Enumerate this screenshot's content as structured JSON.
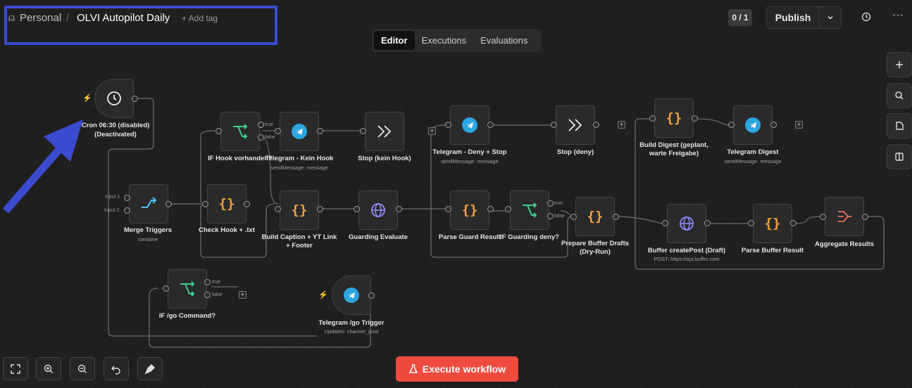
{
  "header": {
    "project": "Personal",
    "workflow_name": "OLVI Autopilot Daily",
    "add_tag": "+ Add tag",
    "counter": "0 / 1",
    "publish": "Publish"
  },
  "tabs": [
    {
      "label": "Editor",
      "active": true
    },
    {
      "label": "Executions",
      "active": false
    },
    {
      "label": "Evaluations",
      "active": false
    }
  ],
  "nodes": {
    "cron": {
      "title": "Cron 06:30 (disabled)",
      "title2": "(Deactivated)"
    },
    "merge": {
      "title": "Merge Triggers",
      "sub": "combine",
      "in1": "Input 1",
      "in2": "Input 2"
    },
    "if_hook": {
      "title": "IF Hook vorhanden?"
    },
    "tg_kein_hook": {
      "title": "Telegram - Kein Hook",
      "sub": "sendMessage: message"
    },
    "stop_kein_hook": {
      "title": "Stop (kein Hook)"
    },
    "tg_deny_stop": {
      "title": "Telegram - Deny + Stop",
      "sub": "sendMessage: message"
    },
    "stop_deny": {
      "title": "Stop (deny)"
    },
    "build_digest": {
      "title": "Build Digest (geplant,",
      "title2": "warte Freigabe)"
    },
    "tg_digest": {
      "title": "Telegram Digest",
      "sub": "sendMessage: message"
    },
    "check_hook": {
      "title": "Check Hook + .txt"
    },
    "build_caption": {
      "title": "Build Caption + YT Link",
      "title2": "+ Footer"
    },
    "guarding_eval": {
      "title": "Guarding Evaluate"
    },
    "parse_guard": {
      "title": "Parse Guard Result"
    },
    "if_guard_deny": {
      "title": "IF Guarding deny?"
    },
    "prepare_buffer": {
      "title": "Prepare Buffer Drafts",
      "title2": "(Dry-Run)"
    },
    "buffer_create": {
      "title": "Buffer createPost (Draft)",
      "sub": "POST: https://api.buffer.com"
    },
    "parse_buffer": {
      "title": "Parse Buffer Result"
    },
    "aggregate": {
      "title": "Aggregate Results"
    },
    "if_go": {
      "title": "IF /go Command?"
    },
    "tg_go_trigger": {
      "title": "Telegram /go Trigger",
      "sub": "Updates: channel_post"
    }
  },
  "ports": {
    "true": "true",
    "false": "false"
  },
  "execute": "Execute workflow",
  "icons": [
    "clock-icon",
    "telegram-icon",
    "if-branch-icon",
    "merge-icon",
    "code-braces-icon",
    "globe-icon",
    "stop-arrows-icon",
    "aggregate-icon",
    "plus-icon",
    "search-icon",
    "note-icon",
    "panel-icon",
    "history-icon",
    "more-icon",
    "fit-view-icon",
    "zoom-in-icon",
    "zoom-out-icon",
    "undo-icon",
    "clean-icon",
    "flask-icon",
    "bolt-icon",
    "chevron-down-icon"
  ],
  "colors": {
    "accent": "#ef4a3e",
    "highlight": "#3a4bd0",
    "code": "#f0a23c",
    "if": "#3ecf8e",
    "merge": "#4fc3f7",
    "globe": "#8f8cff",
    "telegram": "#2ca5e0"
  }
}
